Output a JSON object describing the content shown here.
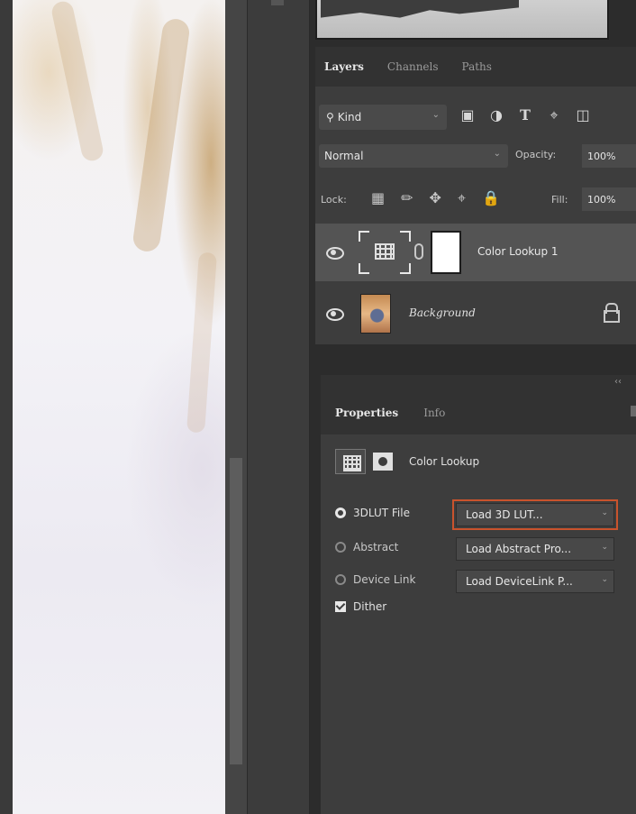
{
  "layers_panel": {
    "tabs": [
      "Layers",
      "Channels",
      "Paths"
    ],
    "kind_filter": "Kind",
    "blend_mode": "Normal",
    "opacity_label": "Opacity:",
    "opacity_value": "100%",
    "lock_label": "Lock:",
    "fill_label": "Fill:",
    "fill_value": "100%",
    "layers": [
      {
        "name": "Color Lookup 1",
        "selected": true
      },
      {
        "name": "Background",
        "selected": false
      }
    ]
  },
  "properties_panel": {
    "tabs": [
      "Properties",
      "Info"
    ],
    "adjustment_label": "Color Lookup",
    "options": [
      {
        "label": "3DLUT File",
        "selected": true,
        "dropdown": "Load 3D LUT..."
      },
      {
        "label": "Abstract",
        "selected": false,
        "dropdown": "Load Abstract Pro..."
      },
      {
        "label": "Device Link",
        "selected": false,
        "dropdown": "Load DeviceLink P..."
      }
    ],
    "dither_label": "Dither",
    "dither_checked": true
  },
  "colors": {
    "highlight": "#c9532d",
    "panel_bg": "#3d3d3d",
    "selected_row": "#545454"
  }
}
